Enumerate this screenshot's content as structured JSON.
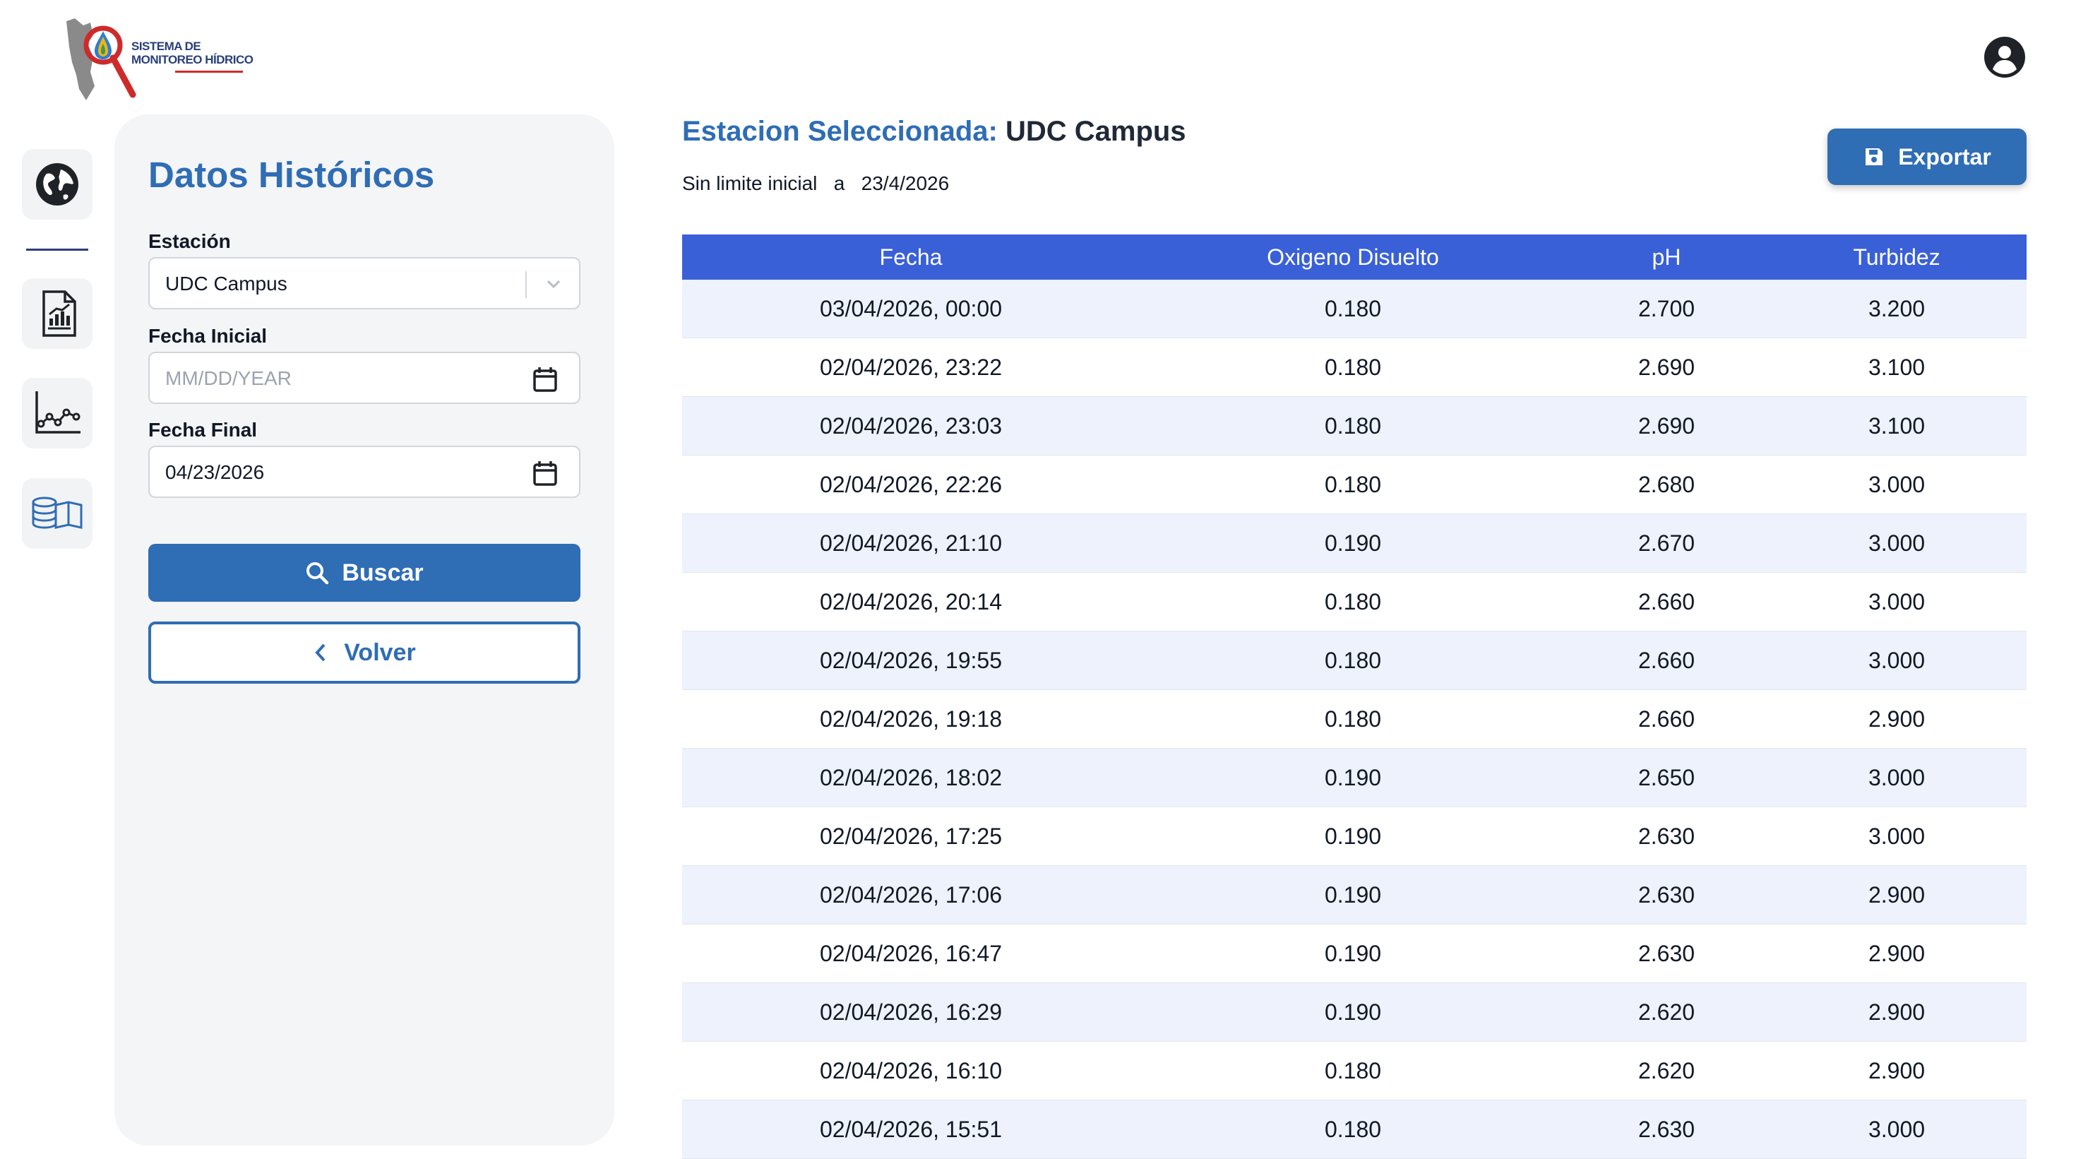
{
  "logo": {
    "line1": "SISTEMA DE",
    "line2": "MONITOREO HÍDRICO"
  },
  "sidebar": {
    "items": [
      {
        "icon": "globe-icon"
      },
      {
        "icon": "report-chart-icon"
      },
      {
        "icon": "line-chart-icon"
      },
      {
        "icon": "database-book-icon"
      }
    ]
  },
  "panel": {
    "title": "Datos Históricos",
    "station_label": "Estación",
    "station_value": "UDC Campus",
    "start_label": "Fecha Inicial",
    "start_placeholder": "MM/DD/YEAR",
    "end_label": "Fecha Final",
    "end_value": "04/23/2026",
    "search_label": "Buscar",
    "back_label": "Volver"
  },
  "main": {
    "station_prefix": "Estacion Seleccionada:",
    "station_name": "UDC Campus",
    "range_text": "Sin limite inicial   a   23/4/2026",
    "export_label": "Exportar"
  },
  "table": {
    "headers": [
      "Fecha",
      "Oxigeno Disuelto",
      "pH",
      "Turbidez"
    ],
    "rows": [
      [
        "03/04/2026, 00:00",
        "0.180",
        "2.700",
        "3.200"
      ],
      [
        "02/04/2026, 23:22",
        "0.180",
        "2.690",
        "3.100"
      ],
      [
        "02/04/2026, 23:03",
        "0.180",
        "2.690",
        "3.100"
      ],
      [
        "02/04/2026, 22:26",
        "0.180",
        "2.680",
        "3.000"
      ],
      [
        "02/04/2026, 21:10",
        "0.190",
        "2.670",
        "3.000"
      ],
      [
        "02/04/2026, 20:14",
        "0.180",
        "2.660",
        "3.000"
      ],
      [
        "02/04/2026, 19:55",
        "0.180",
        "2.660",
        "3.000"
      ],
      [
        "02/04/2026, 19:18",
        "0.180",
        "2.660",
        "2.900"
      ],
      [
        "02/04/2026, 18:02",
        "0.190",
        "2.650",
        "3.000"
      ],
      [
        "02/04/2026, 17:25",
        "0.190",
        "2.630",
        "3.000"
      ],
      [
        "02/04/2026, 17:06",
        "0.190",
        "2.630",
        "2.900"
      ],
      [
        "02/04/2026, 16:47",
        "0.190",
        "2.630",
        "2.900"
      ],
      [
        "02/04/2026, 16:29",
        "0.190",
        "2.620",
        "2.900"
      ],
      [
        "02/04/2026, 16:10",
        "0.180",
        "2.620",
        "2.900"
      ],
      [
        "02/04/2026, 15:51",
        "0.180",
        "2.630",
        "3.000"
      ]
    ]
  },
  "colors": {
    "brand": "#2f6db5",
    "table_header": "#3a60d8",
    "row_alt": "#edf2fc",
    "panel_bg": "#f4f5f7"
  }
}
